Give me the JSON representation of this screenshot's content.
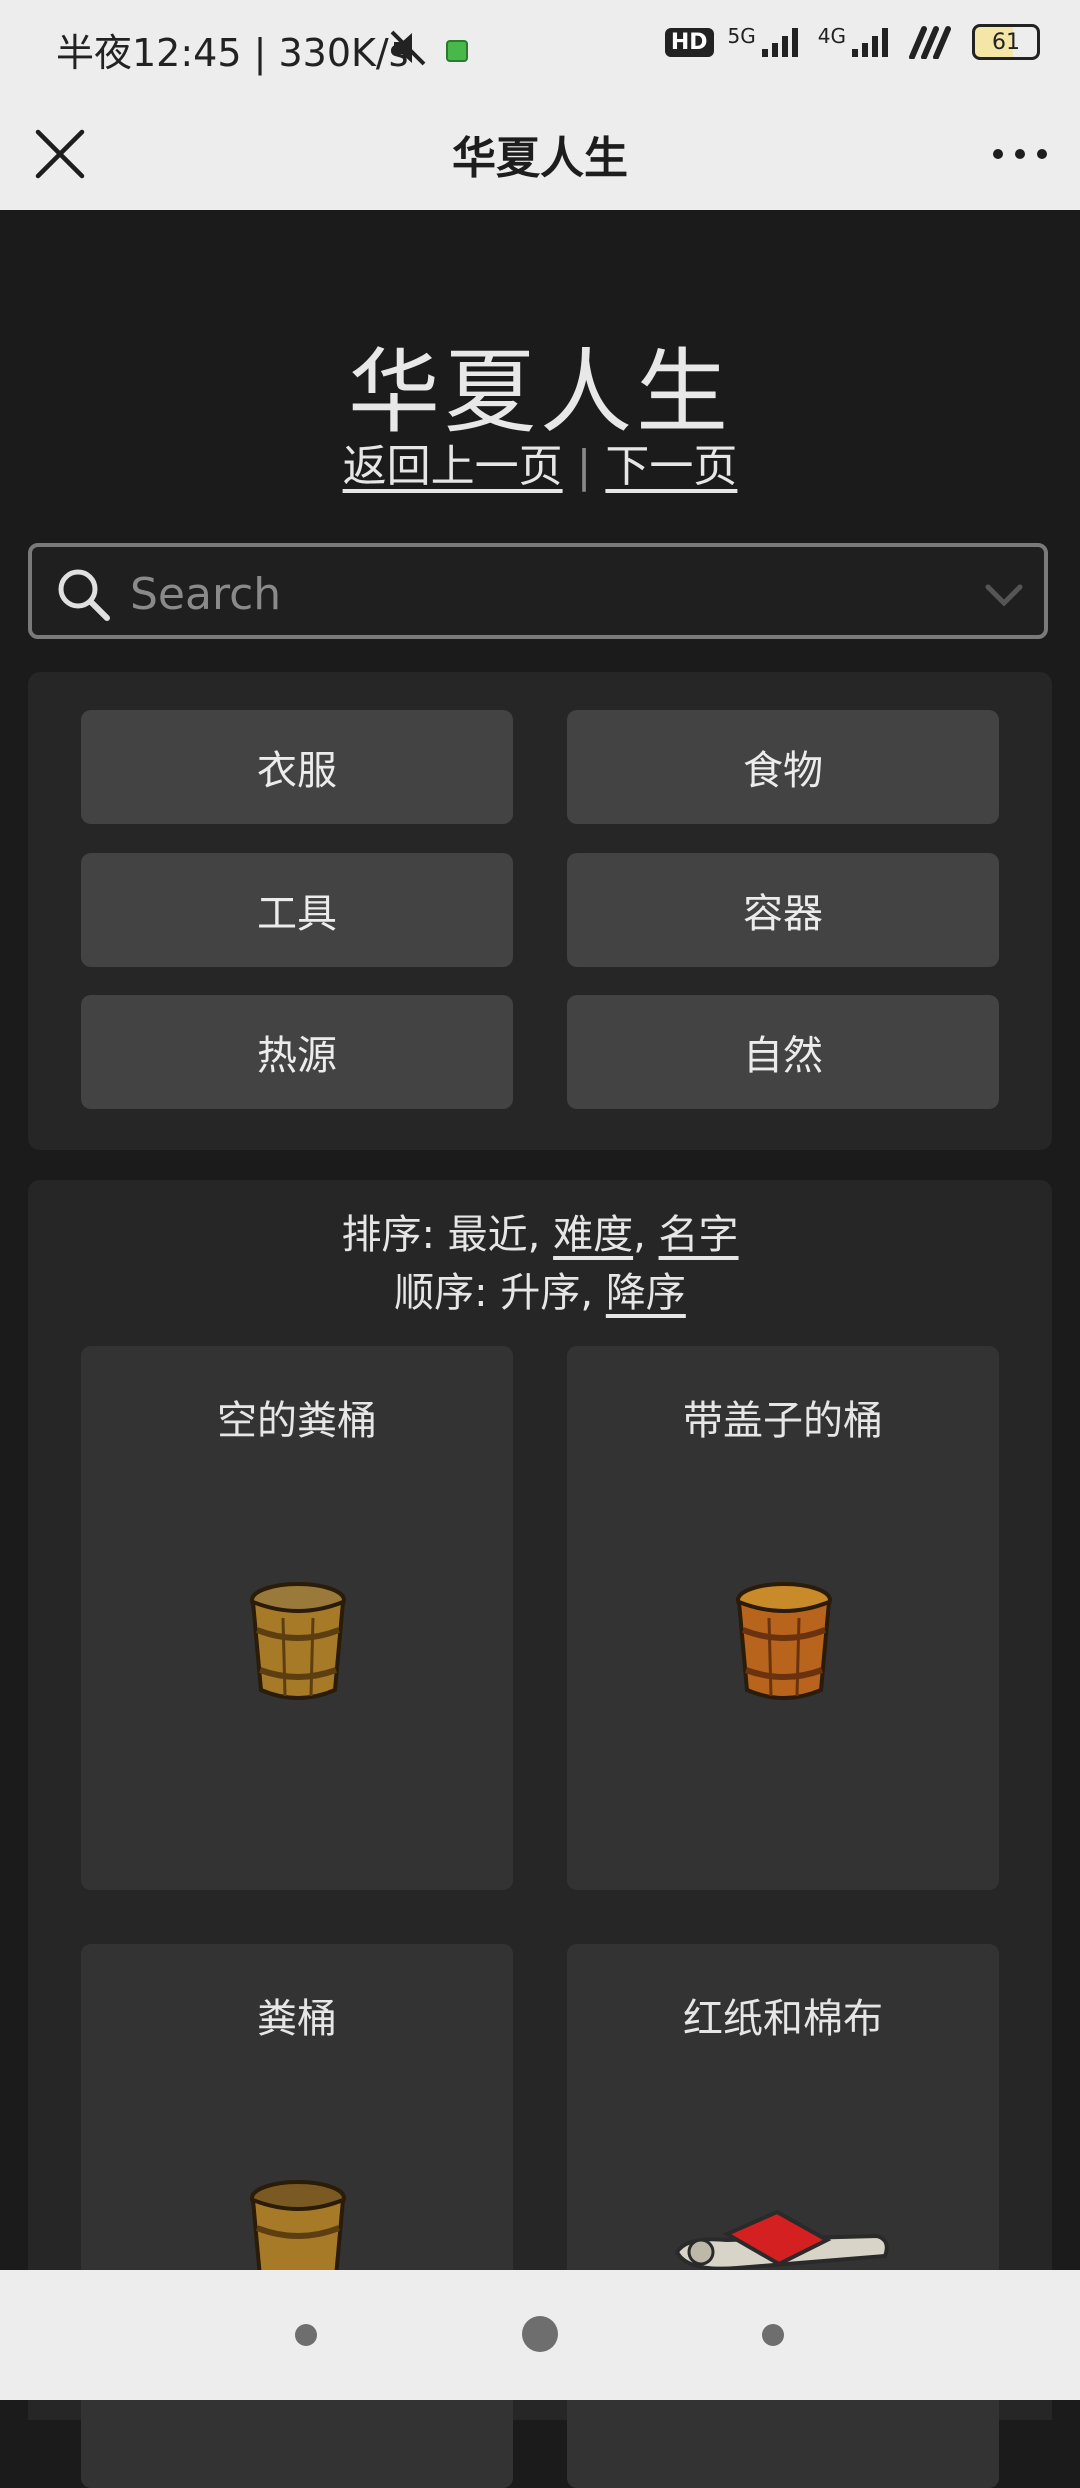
{
  "status_bar": {
    "time_text": "半夜12:45 | 330K/s",
    "network_1": "5G",
    "network_2": "4G",
    "hd_label": "HD",
    "battery_level": "61"
  },
  "app_bar": {
    "title": "华夏人生"
  },
  "header": {
    "title": "华夏人生",
    "back_link": "返回上一页",
    "separator": "|",
    "next_link": "下一页"
  },
  "search": {
    "placeholder": "Search"
  },
  "categories": [
    {
      "label": "衣服"
    },
    {
      "label": "食物"
    },
    {
      "label": "工具"
    },
    {
      "label": "容器"
    },
    {
      "label": "热源"
    },
    {
      "label": "自然"
    }
  ],
  "sort": {
    "sort_label": "排序:",
    "sort_recent": "最近,",
    "sort_difficulty": "难度",
    "sort_comma": ",",
    "sort_name": "名字",
    "order_label": "顺序:",
    "order_asc": "升序,",
    "order_desc": "降序"
  },
  "items": [
    {
      "name": "空的粪桶",
      "icon": "wooden-bucket-icon"
    },
    {
      "name": "带盖子的桶",
      "icon": "lidded-bucket-icon"
    },
    {
      "name": "粪桶",
      "icon": "dung-bucket-icon"
    },
    {
      "name": "红纸和棉布",
      "icon": "red-paper-cloth-icon"
    }
  ],
  "colors": {
    "background": "#1b1b1b",
    "panel": "#262626",
    "button": "#434343",
    "card": "#333333",
    "chrome": "#ededed"
  }
}
